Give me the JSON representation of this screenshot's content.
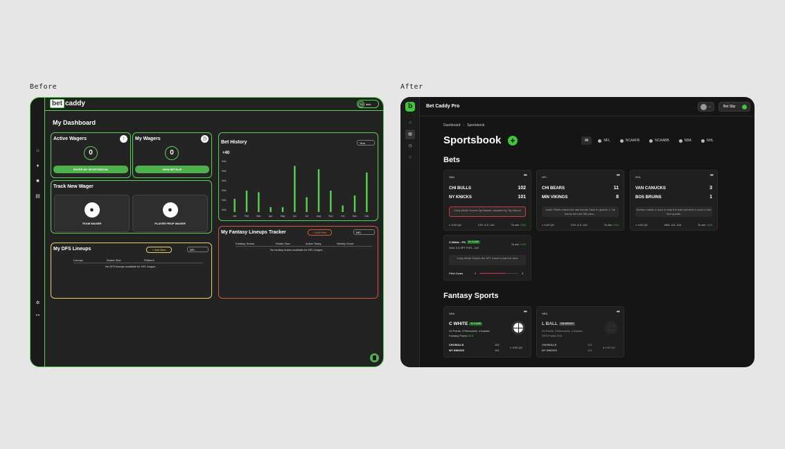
{
  "captions": {
    "before": "Before",
    "after": "After"
  },
  "before": {
    "logo": {
      "bet": "bet",
      "caddy": "caddy"
    },
    "user": {
      "initials": "TB",
      "name": "tash"
    },
    "dashboard_title": "My Dashboard",
    "active_wagers": {
      "title": "Active Wagers",
      "count": "0",
      "button": "ENTER MY SPORTSBOOK"
    },
    "my_wagers": {
      "title": "My Wagers",
      "count": "0",
      "button": "VIEW BETSLIP"
    },
    "track": {
      "title": "Track New Wager",
      "team": "TEAM WAGER",
      "player": "PLAYER PROP WAGER"
    },
    "dfs": {
      "title": "My DFS Lineups",
      "add": "+ Add New",
      "league": "NFL",
      "columns": [
        "Lineups",
        "Roster Size",
        "Platform"
      ],
      "empty": "No DFS lineups available for NFL league."
    },
    "history": {
      "title": "Bet History",
      "range": "Year",
      "total": "+40",
      "yticks": [
        "N/A",
        "N/A",
        "N/A",
        "N/A",
        "N/A",
        "N/A"
      ]
    },
    "fantasy": {
      "title": "My Fantasy Lineups Tracker",
      "add": "+ Add New",
      "league": "NFL",
      "columns": [
        "Fantasy Teams",
        "Roster Size",
        "Active Today",
        "Weekly Score"
      ],
      "empty": "No fantasy teams available for NFL league."
    }
  },
  "chart_data": {
    "type": "bar",
    "title": "Bet History",
    "categories": [
      "Jan",
      "Feb",
      "Mar",
      "Apr",
      "May",
      "Jun",
      "Jul",
      "Aug",
      "Sep",
      "Oct",
      "Nov",
      "Dec"
    ],
    "values": [
      4,
      6.5,
      6,
      1.5,
      1.5,
      14,
      4.5,
      13,
      6.5,
      2,
      5,
      12
    ],
    "ylim": [
      0,
      16
    ],
    "color": "#58d455"
  },
  "after": {
    "app_title": "Bet Caddy Pro",
    "logo_letter": "b",
    "bet_slip": "Bet Slip",
    "breadcrumb": [
      "Dashboard",
      "Sportsbook"
    ],
    "heading": "Sportsbook",
    "filters": [
      "All",
      "NFL",
      "NCAAFB",
      "NCAABB",
      "NBA",
      "NHL"
    ],
    "bets_title": "Bets",
    "bets": [
      {
        "league": "NBA",
        "team1": "CHI BULLS",
        "score1": "102",
        "team2": "NY KNICKS",
        "score2": "101",
        "note": "Coby White Scores 3pt Basket. Assisted by Taj Gibson",
        "alert": true,
        "clock": "4:02 Q4",
        "line": "CHI -4.5 -110",
        "towin_label": "To win",
        "towin": "+110"
      },
      {
        "league": "NFL",
        "team1": "CHI BEARS",
        "score1": "11",
        "team2": "MIN VIKINGS",
        "score2": "8",
        "note": "Justin Fields makes the last minute Save in quarter 1. He barely let's the 9th pass...",
        "alert": false,
        "clock": "4:02 Q2",
        "line": "CHI -4.5 -110",
        "towin_label": "To win",
        "towin": "+110"
      },
      {
        "league": "NHL",
        "team1": "VAN CANUCKS",
        "score1": "3",
        "team2": "BOS BRUINS",
        "score2": "1",
        "note": "Demko makes a save to help the team prevent a score in the first quarter",
        "alert": false,
        "clock": "4:02 Q1",
        "line": "VAN -4.5 -110",
        "towin_label": "To win",
        "towin": "+110"
      }
    ],
    "prop": {
      "player": "C.White - FG",
      "badge": "IN GAME",
      "towin_label": "To win",
      "towin": "+110",
      "line": "Over 2.5 3PT FGS - 110",
      "note": "Coby White Scores the 3PT. Insert a stat line here",
      "stat": "Field Goals",
      "progress_from": "2",
      "progress_to": "3",
      "progress": 0.67
    },
    "fantasy_title": "Fantasy Sports",
    "fantasy": [
      {
        "league": "NBA",
        "player": "C WHITE",
        "badge": "IN GAME",
        "badge_style": "green",
        "stats": "23 Points, 3 Rebounds, 4 Assists",
        "points_label": "Fantasy Points",
        "points": "20.6",
        "team1": "CHI BULLS",
        "score1": "102",
        "team2": "NY KNICKS",
        "score2": "101",
        "clock": "4:02 Q4"
      },
      {
        "league": "NBA",
        "player": "L BALL",
        "badge": "ON BENCH",
        "badge_style": "gray",
        "stats": "23 Points, 3 Rebounds, 4 Assists",
        "points_label": "DFS Points",
        "points": "20.6",
        "team1": "CHI BULLS",
        "score1": "102",
        "team2": "NY KNICKS",
        "score2": "101",
        "clock": "4:02 Q4"
      }
    ]
  }
}
